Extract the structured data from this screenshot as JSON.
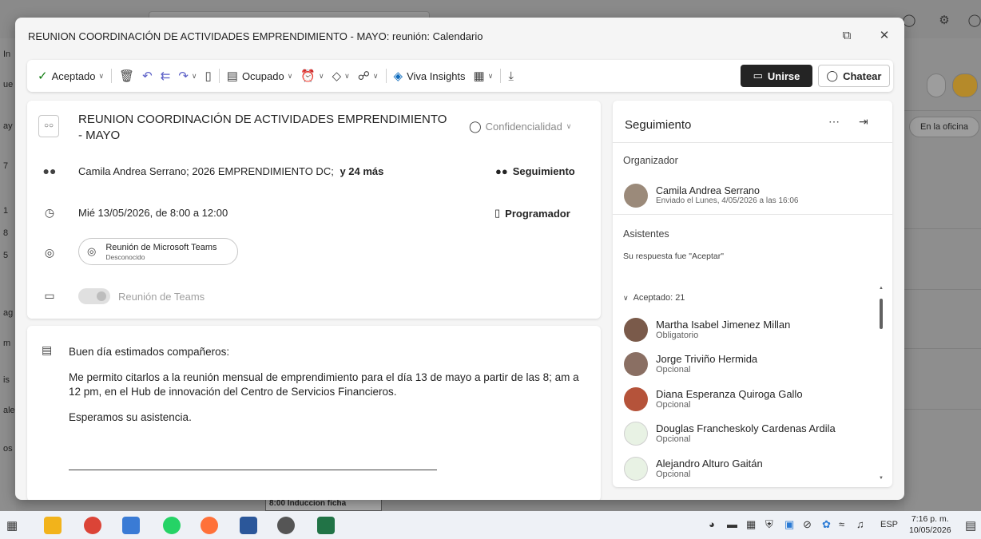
{
  "background": {
    "left_labels": [
      "In",
      "ue",
      "ay",
      "7",
      "1",
      "8",
      "5",
      "ag",
      "m",
      "is",
      "ale",
      "os"
    ],
    "right_button": "En la oficina",
    "event_label": "8:00 Induccion ficha"
  },
  "modal": {
    "title": "REUNION COORDINACIÓN DE ACTIVIDADES EMPRENDIMIENTO - MAYO: reunión: Calendario"
  },
  "toolbar": {
    "accepted_label": "Aceptado",
    "busy_label": "Ocupado",
    "viva_label": "Viva Insights",
    "join_label": "Unirse",
    "chat_label": "Chatear"
  },
  "details": {
    "subject_line1": "REUNION COORDINACIÓN DE ACTIVIDADES EMPRENDIMIENTO",
    "subject_line2": "- MAYO",
    "confidentiality": "Confidencialidad",
    "attendees_text": "Camila Andrea Serrano;  2026 EMPRENDIMIENTO DC;",
    "attendees_more": "y 24 más",
    "tracking_link": "Seguimiento",
    "datetime": "Mié 13/05/2026, de 8:00 a 12:00",
    "scheduler_link": "Programador",
    "location_name": "Reunión de Microsoft Teams",
    "location_status": "Desconocido",
    "teams_toggle_label": "Reunión de Teams"
  },
  "body": {
    "greeting": "Buen día estimados compañeros:",
    "paragraph": "Me permito citarlos a la reunión mensual de emprendimiento para el día 13 de mayo a partir de las 8; am a 12 pm, en el Hub de innovación del Centro de Servicios Financieros.",
    "closing": "Esperamos su asistencia."
  },
  "tracking": {
    "title": "Seguimiento",
    "organizer_label": "Organizador",
    "organizer_name": "Camila Andrea Serrano",
    "organizer_sent": "Enviado el Lunes, 4/05/2026 a las 16:06",
    "attendees_label": "Asistentes",
    "response_text": "Su respuesta fue \"Aceptar\"",
    "accepted_group": "Aceptado: 21",
    "people": [
      {
        "name": "Martha Isabel Jimenez Millan",
        "role": "Obligatorio",
        "color": "#7a5a4a"
      },
      {
        "name": "Jorge Triviño Hermida",
        "role": "Opcional",
        "color": "#8a6f63"
      },
      {
        "name": "Diana Esperanza Quiroga Gallo",
        "role": "Opcional",
        "color": "#b5533a"
      },
      {
        "name": "Douglas Francheskoly Cardenas Ardila",
        "role": "Opcional",
        "color": "#e8f2e4"
      },
      {
        "name": "Alejandro Alturo Gaitán",
        "role": "Opcional",
        "color": "#e8f2e4"
      }
    ]
  },
  "taskbar": {
    "language": "ESP",
    "time": "7:16 p. m.",
    "date": "10/05/2026"
  },
  "colors": {
    "accent": "#0f6cbd",
    "accepted_green": "#107c10",
    "join_button": "#242424"
  }
}
